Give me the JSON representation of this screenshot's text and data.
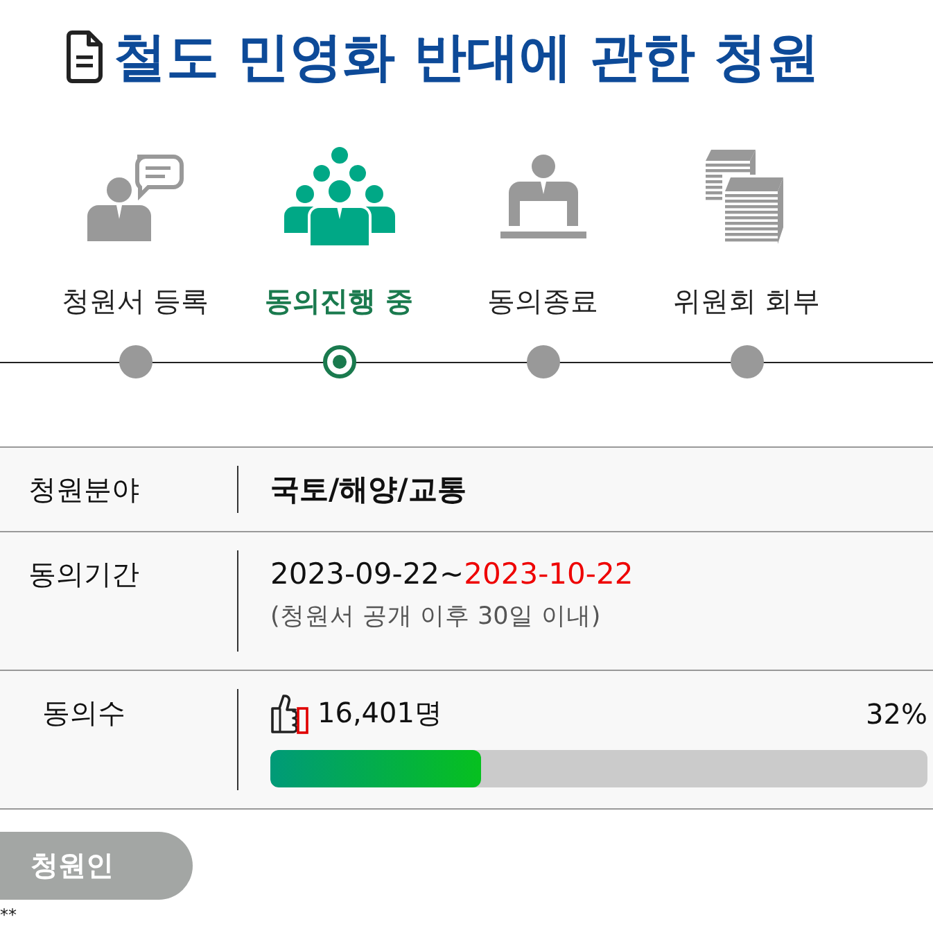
{
  "title": {
    "text": "철도 민영화 반대에 관한 청원"
  },
  "steps": [
    {
      "label": "청원서 등록",
      "selected": false
    },
    {
      "label": "동의진행 중",
      "selected": true
    },
    {
      "label": "동의종료",
      "selected": false
    },
    {
      "label": "위원회 회부",
      "selected": false
    }
  ],
  "details": [
    {
      "kind": "text",
      "label": "청원분야",
      "value": "국토/해양/교통"
    },
    {
      "kind": "period",
      "label": "동의기간",
      "start": "2023-09-22~",
      "end": "2023-10-22",
      "note": "(청원서 공개 이후 30일 이내)"
    },
    {
      "kind": "progress",
      "label": "동의수",
      "count": "16,401명",
      "percent": "32%",
      "level": 0.32
    }
  ],
  "petitioner_tab": {
    "label": "청원인"
  },
  "petitioner_name": "**"
}
